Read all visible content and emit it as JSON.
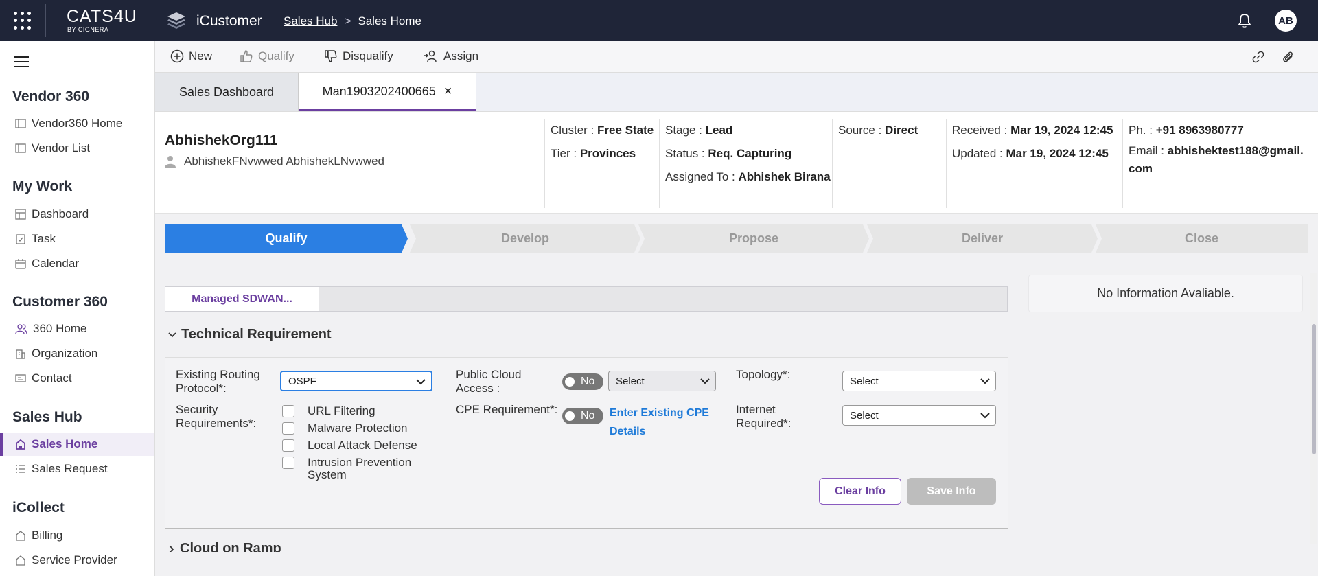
{
  "topbar": {
    "logo_main": "CATS4U",
    "logo_sub": "BY CIGNERA",
    "app_name": "iCustomer",
    "breadcrumb": [
      "Sales Hub",
      "Sales Home"
    ],
    "avatar": "AB"
  },
  "sidebar": {
    "sections": [
      {
        "title": "Vendor 360",
        "items": [
          "Vendor360 Home",
          "Vendor List"
        ]
      },
      {
        "title": "My Work",
        "items": [
          "Dashboard",
          "Task",
          "Calendar"
        ]
      },
      {
        "title": "Customer 360",
        "items": [
          "360 Home",
          "Organization",
          "Contact"
        ]
      },
      {
        "title": "Sales Hub",
        "items": [
          "Sales Home",
          "Sales Request"
        ]
      },
      {
        "title": "iCollect",
        "items": [
          "Billing",
          "Service Provider"
        ]
      }
    ],
    "active_item": "Sales Home"
  },
  "toolbar": {
    "new": "New",
    "qualify": "Qualify",
    "disqualify": "Disqualify",
    "assign": "Assign"
  },
  "tabs": [
    "Sales Dashboard",
    "Man1903202400665"
  ],
  "header": {
    "org_name": "AbhishekOrg111",
    "contact_name": "AbhishekFNvwwed AbhishekLNvwwed",
    "cluster_label": "Cluster :",
    "cluster": "Free State",
    "tier_label": "Tier :",
    "tier": "Provinces",
    "stage_label": "Stage :",
    "stage": "Lead",
    "status_label": "Status :",
    "status": "Req. Capturing",
    "assigned_label": "Assigned To :",
    "assigned": "Abhishek Birana",
    "source_label": "Source :",
    "source": "Direct",
    "received_label": "Received :",
    "received": "Mar 19, 2024 12:45",
    "updated_label": "Updated :",
    "updated": "Mar 19, 2024 12:45",
    "phone_label": "Ph. :",
    "phone": "+91 8963980777",
    "email_label": "Email :",
    "email_line1": "abhishektest188@gmail.",
    "email_line2": "com"
  },
  "stages": [
    "Qualify",
    "Develop",
    "Propose",
    "Deliver",
    "Close"
  ],
  "active_stage": "Qualify",
  "product_tab": "Managed SDWAN...",
  "section_title": "Technical Requirement",
  "form": {
    "routing_label_1": "Existing Routing",
    "routing_label_2": "Protocol*:",
    "routing_value": "OSPF",
    "security_label_1": "Security",
    "security_label_2": "Requirements*:",
    "security_options": [
      "URL Filtering",
      "Malware Protection",
      "Local Attack Defense",
      "Intrusion Prevention",
      "System"
    ],
    "cloud_label_1": "Public Cloud",
    "cloud_label_2": "Access :",
    "cloud_toggle": "No",
    "cloud_select": "Select",
    "cpe_label": "CPE Requirement*:",
    "cpe_toggle": "No",
    "cpe_link_1": "Enter Existing CPE",
    "cpe_link_2": "Details",
    "topology_label": "Topology*:",
    "topology_select": "Select",
    "internet_label_1": "Internet",
    "internet_label_2": "Required*:",
    "internet_select": "Select",
    "clear_btn": "Clear Info",
    "save_btn": "Save Info"
  },
  "next_section": "Cloud on Ramp",
  "info_panel": "No Information Avaliable.",
  "colors": {
    "accent": "#6b3fa0",
    "stage_active": "#2b7fe3",
    "topbar": "#1f2538",
    "link": "#1e7ad8"
  }
}
